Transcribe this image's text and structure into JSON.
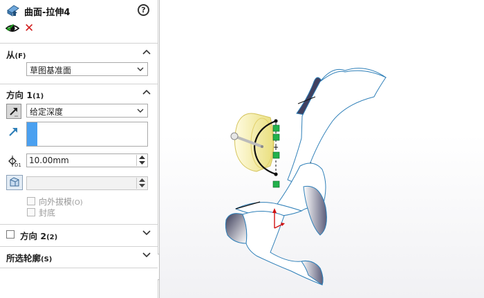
{
  "feature": {
    "title": "曲面-拉伸4",
    "help": "?"
  },
  "actions": {
    "ok": "✔",
    "cancel": "✕"
  },
  "from": {
    "title": "从",
    "shortcut": "(F)",
    "selected": "草图基准面"
  },
  "direction1": {
    "title": "方向 1",
    "shortcut": "(1)",
    "end_condition": "给定深度",
    "depth": "10.00mm",
    "draft_value": "",
    "draft_outward": {
      "label": "向外拔模",
      "shortcut": "(O)"
    },
    "cap_end": {
      "label": "封底"
    }
  },
  "direction2": {
    "title": "方向 2",
    "shortcut": "(2)"
  },
  "selected_contours": {
    "title": "所选轮廓",
    "shortcut": "(S)"
  },
  "icons": {
    "feature": "extruded-surface-icon",
    "help": "help-icon",
    "ok": "check-icon",
    "cancel": "close-icon",
    "preview": "eye-icon",
    "reverse": "reverse-direction-icon",
    "direction": "direction-arrow-icon",
    "depth": "depth-icon",
    "draft": "draft-icon"
  },
  "colors": {
    "selection": "#4aa0f0",
    "ok": "#1f9a1f",
    "cancel": "#d21f1f",
    "surface_edge": "#2e7fb8",
    "preview": "#f0e68c",
    "handle": "#22b14c"
  }
}
